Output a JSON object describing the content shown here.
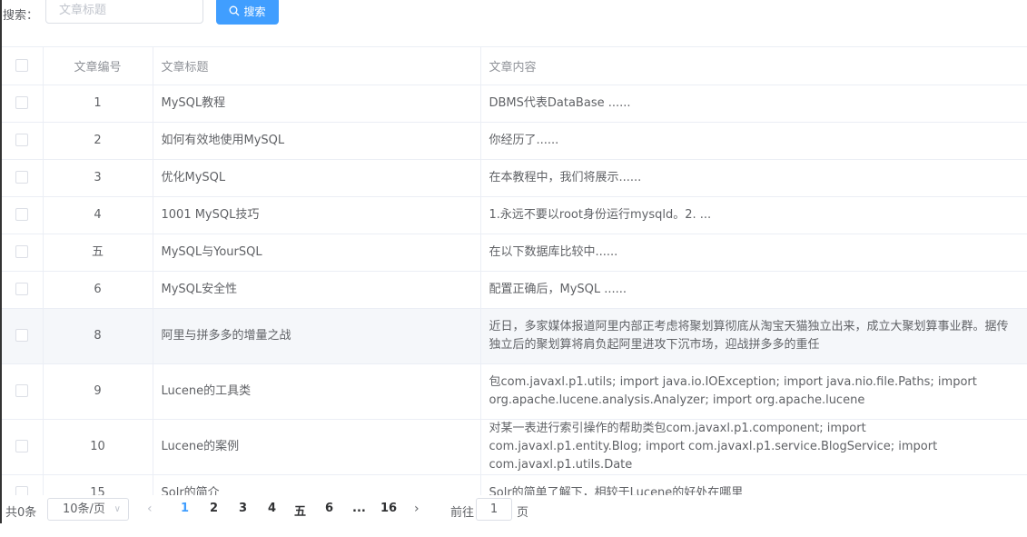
{
  "search": {
    "label": "搜索：",
    "placeholder": "文章标题",
    "button_label": "搜索"
  },
  "table": {
    "columns": [
      "文章编号",
      "文章标题",
      "文章内容"
    ],
    "rows": [
      {
        "id": "1",
        "title": "MySQL教程",
        "content": "DBMS代表DataBase ......"
      },
      {
        "id": "2",
        "title": "如何有效地使用MySQL",
        "content": "你经历了......"
      },
      {
        "id": "3",
        "title": "优化MySQL",
        "content": "在本教程中，我们将展示......"
      },
      {
        "id": "4",
        "title": "1001 MySQL技巧",
        "content": "1.永远不要以root身份运行mysqld。2. ..."
      },
      {
        "id": "五",
        "title": "MySQL与YourSQL",
        "content": "在以下数据库比较中......"
      },
      {
        "id": "6",
        "title": "MySQL安全性",
        "content": "配置正确后，MySQL ......"
      },
      {
        "id": "8",
        "title": "阿里与拼多多的增量之战",
        "content": "近日，多家媒体报道阿里内部正考虑将聚划算彻底从淘宝天猫独立出来，成立大聚划算事业群。据传独立后的聚划算将肩负起阿里进攻下沉市场，迎战拼多多的重任"
      },
      {
        "id": "9",
        "title": "Lucene的工具类",
        "content": "包com.javaxl.p1.utils; import java.io.IOException; import java.nio.file.Paths; import org.apache.lucene.analysis.Analyzer; import org.apache.lucene"
      },
      {
        "id": "10",
        "title": "Lucene的案例",
        "content": "对某一表进行索引操作的帮助类包com.javaxl.p1.component; import com.javaxl.p1.entity.Blog; import com.javaxl.p1.service.BlogService; import com.javaxl.p1.utils.Date"
      },
      {
        "id": "15",
        "title": "Solr的简介",
        "content": "Solr的简单了解下，相较于Lucene的好处在哪里"
      }
    ]
  },
  "pagination": {
    "total": "共0条",
    "page_size": "10条/页",
    "pages": [
      "1",
      "2",
      "3",
      "4",
      "五",
      "6",
      "...",
      "16"
    ],
    "active_page": "1",
    "goto_label": "前往",
    "goto_value": "1",
    "goto_suffix": "页"
  },
  "colors": {
    "primary": "#409eff",
    "border": "#ebeef5",
    "text": "#606266",
    "header_text": "#909399"
  }
}
